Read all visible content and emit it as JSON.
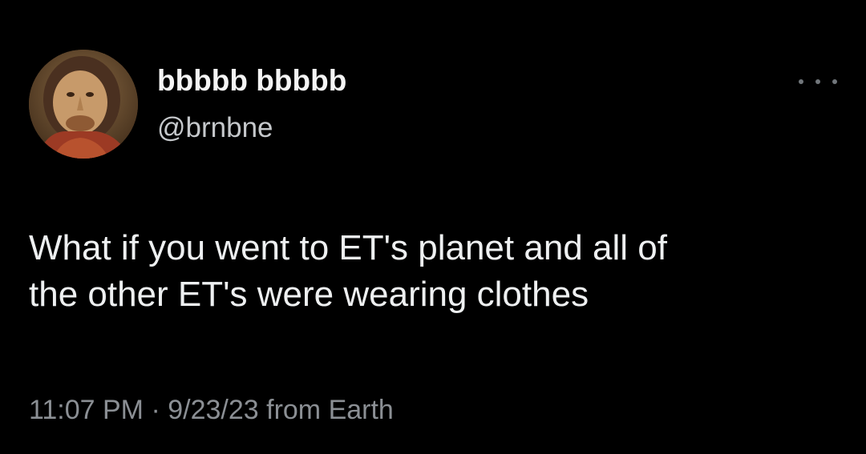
{
  "tweet": {
    "author": {
      "display_name": "bbbbb bbbbb",
      "handle": "@brnbne",
      "avatar_icon": "avatar-portrait-painting"
    },
    "more_icon": "more-horizontal-icon",
    "text": "What if you went to ET's planet and all of\nthe other ET's were wearing clothes",
    "time": "11:07 PM",
    "separator": " · ",
    "date": "9/23/23",
    "source": " from Earth"
  },
  "colors": {
    "background": "#000000",
    "primary_text": "#e7e9ea",
    "secondary_text": "#71767b"
  }
}
